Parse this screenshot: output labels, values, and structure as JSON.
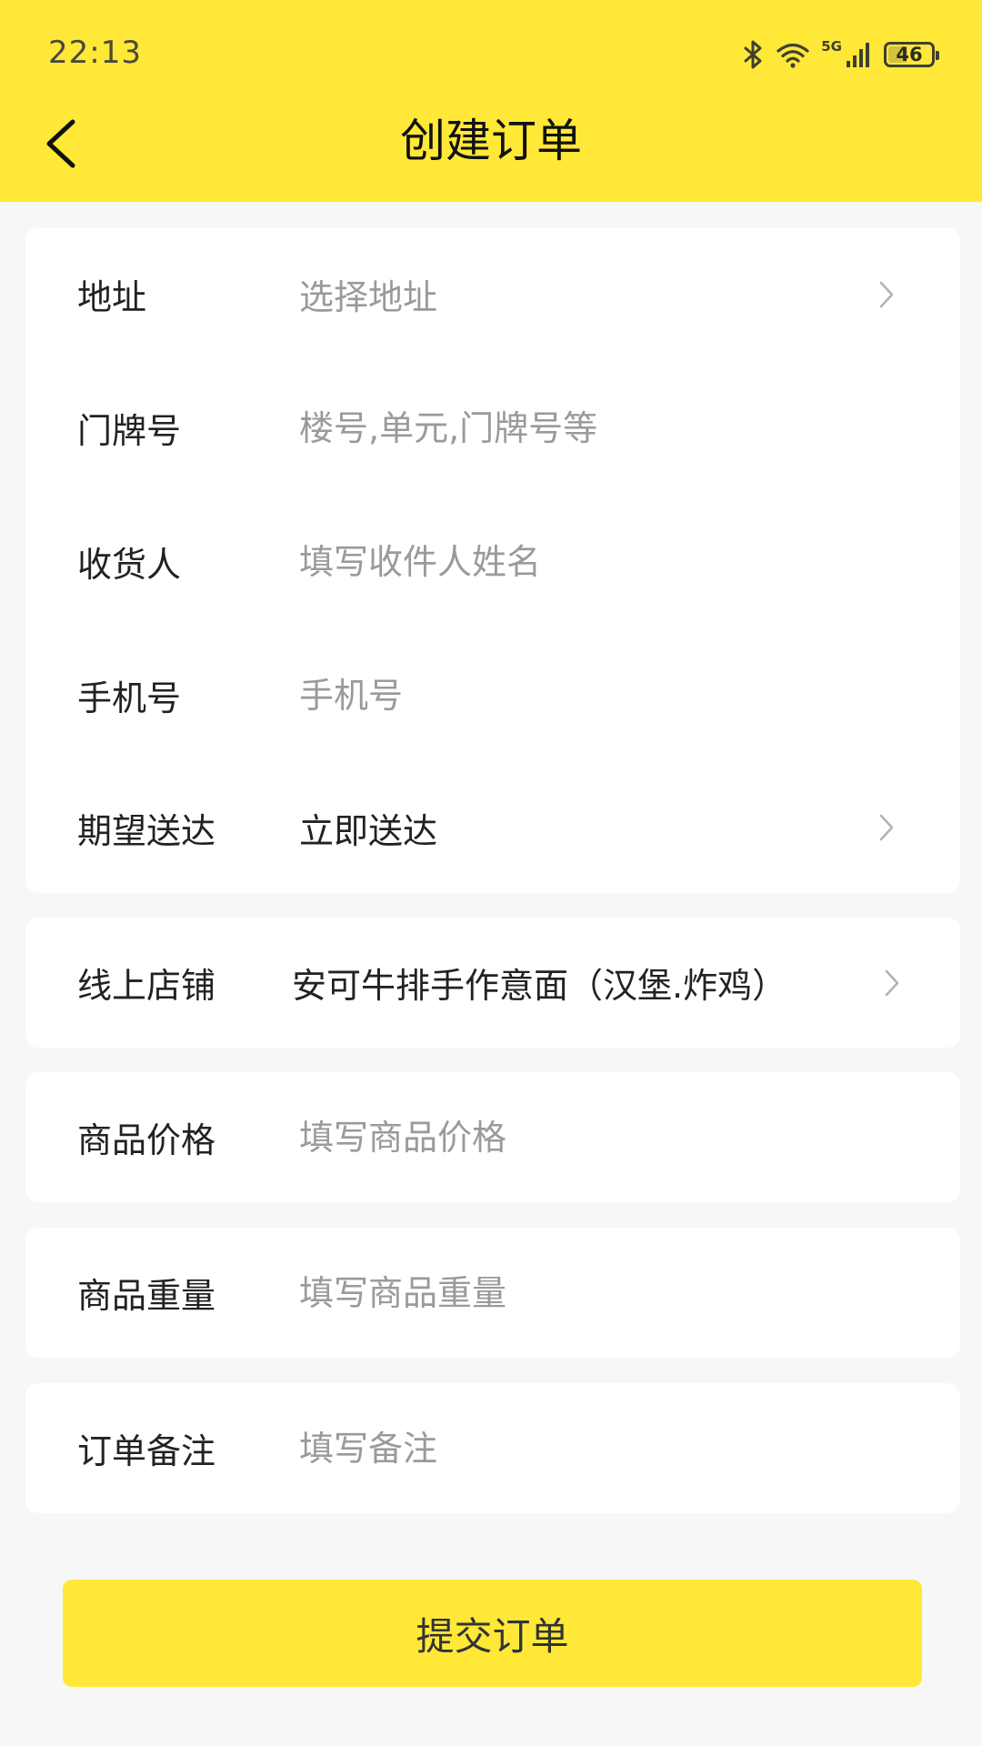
{
  "status_bar": {
    "time": "22:13",
    "network": "5G",
    "battery": "46",
    "battery_level_percent": 46
  },
  "nav": {
    "title": "创建订单"
  },
  "address_card": {
    "rows": [
      {
        "label": "地址",
        "placeholder": "选择地址"
      },
      {
        "label": "门牌号",
        "placeholder": "楼号,单元,门牌号等"
      },
      {
        "label": "收货人",
        "placeholder": "填写收件人姓名"
      },
      {
        "label": "手机号",
        "placeholder": "手机号"
      },
      {
        "label": "期望送达",
        "value": "立即送达"
      }
    ]
  },
  "shop": {
    "label": "线上店铺",
    "value": "安可牛排手作意面（汉堡.炸鸡）"
  },
  "price": {
    "label": "商品价格",
    "placeholder": "填写商品价格"
  },
  "weight": {
    "label": "商品重量",
    "placeholder": "填写商品重量"
  },
  "note": {
    "label": "订单备注",
    "placeholder": "填写备注"
  },
  "submit": {
    "label": "提交订单"
  },
  "colors": {
    "accent": "#ffe838",
    "background": "#f7f7f7",
    "placeholder": "#9a9a9a"
  }
}
